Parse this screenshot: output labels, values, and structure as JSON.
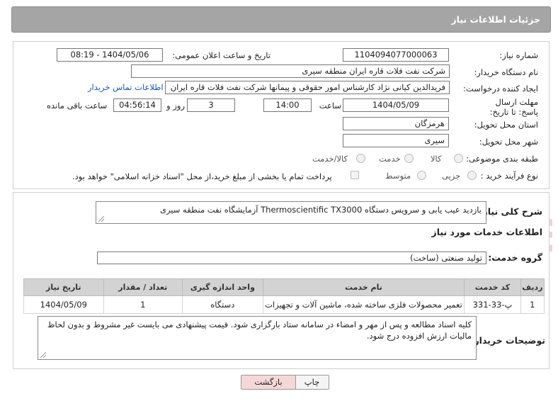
{
  "header": {
    "title": "جزئیات اطلاعات نیاز"
  },
  "fields": {
    "need_number_label": "شماره نیاز:",
    "need_number": "1104094077000063",
    "announce_label": "تاریخ و ساعت اعلان عمومی:",
    "announce_value": "1404/05/06 - 08:19",
    "buyer_label": "نام دستگاه خریدار:",
    "buyer_value": "شرکت نفت فلات قاره ایران منطقه سیری",
    "creator_label": "ایجاد کننده درخواست:",
    "creator_value": "فریدالدین کیانی نژاد کارشناس امور حقوقی و پیمانها شرکت نفت فلات قاره ایران",
    "contact_link": "اطلاعات تماس خریدار",
    "deadline_label": "مهلت ارسال پاسخ: تا تاریخ:",
    "deadline_date": "1404/05/09",
    "time_label": "ساعت",
    "deadline_time": "14:00",
    "days_value": "3",
    "days_label": "روز و",
    "remaining_time": "04:56:14",
    "remaining_label": "ساعت باقی مانده",
    "province_label": "استان محل تحویل:",
    "province_value": "هرمزگان",
    "city_label": "شهر محل تحویل:",
    "city_value": "سیری",
    "category_label": "طبقه بندی موضوعی:",
    "category_options": [
      "کالا",
      "خدمت",
      "کالا/خدمت"
    ],
    "process_label": "نوع فرآیند خرید :",
    "process_options": [
      "جزیی",
      "متوسط"
    ],
    "payment_note": "پرداخت تمام یا بخشی از مبلغ خرید،از محل \"اسناد خزانه اسلامی\" خواهد بود."
  },
  "summary": {
    "label": "شرح کلی نیاز:",
    "value": "بازدید عیب یابی و سرویس دستگاه Thermoscientific TX3000 آزمایشگاه نفت منطقه سیری"
  },
  "services": {
    "section_title": "اطلاعات خدمات مورد نیاز",
    "group_label": "گروه خدمت:",
    "group_value": "تولید صنعتی (ساخت)",
    "columns": [
      "ردیف",
      "کد خدمت",
      "نام خدمت",
      "واحد اندازه گیری",
      "تعداد / مقدار",
      "تاریخ نیاز"
    ],
    "rows": [
      [
        "1",
        "پ-33-331",
        "تعمیر محصولات فلزی ساخته شده، ماشین آلات و تجهیزات",
        "دستگاه",
        "1",
        "1404/05/09"
      ]
    ]
  },
  "buyer_notes": {
    "label": "توضیحات خریدار:",
    "value": "کلیه اسناد مطالعه و پس از مهر و امضاء در سامانه ستاد بارگزاری شود. قیمت پیشنهادی می بایست غیر مشروط و بدون لحاظ مالیات ارزش افزوده درج شود."
  },
  "buttons": {
    "print": "چاپ",
    "back": "بازگشت"
  },
  "watermark_text": "AriaTender.neT",
  "colors": {
    "titlebar": "#a5a5a5",
    "link": "#1a56b0",
    "back_button": "#f6d7d7",
    "watermark": "#e9b9b9"
  }
}
